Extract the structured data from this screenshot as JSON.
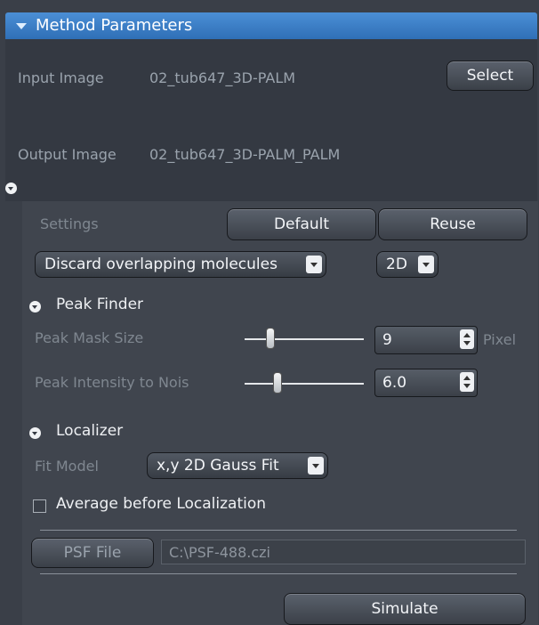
{
  "header": {
    "title": "Method Parameters"
  },
  "input_image": {
    "label": "Input Image",
    "value": "02_tub647_3D-PALM",
    "select_button": "Select"
  },
  "output_image": {
    "label": "Output Image",
    "value": "02_tub647_3D-PALM_PALM"
  },
  "settings": {
    "label": "Settings",
    "default_button": "Default",
    "reuse_button": "Reuse"
  },
  "overlap_dropdown": {
    "selected": "Discard overlapping molecules"
  },
  "dimension_dropdown": {
    "selected": "2D"
  },
  "peak_finder": {
    "title": "Peak Finder",
    "mask_size": {
      "label": "Peak Mask Size",
      "value": "9",
      "unit": "Pixel"
    },
    "intensity": {
      "label": "Peak Intensity to Nois",
      "value": "6.0"
    }
  },
  "localizer": {
    "title": "Localizer",
    "fit_model_label": "Fit Model",
    "fit_model_selected": "x,y 2D Gauss Fit",
    "average_label": "Average before Localization",
    "average_checked": false
  },
  "psf": {
    "button": "PSF File",
    "path": "C:\\PSF-488.czi"
  },
  "simulate_button": "Simulate",
  "colors": {
    "accent": "#3a7fcb",
    "panel": "#3a3f48",
    "text_dim": "#9aa3ad"
  },
  "icons": [
    "collapse-triangle-icon",
    "collapse-circle-icon",
    "dropdown-arrow-icon",
    "spinner-arrows-icon"
  ]
}
